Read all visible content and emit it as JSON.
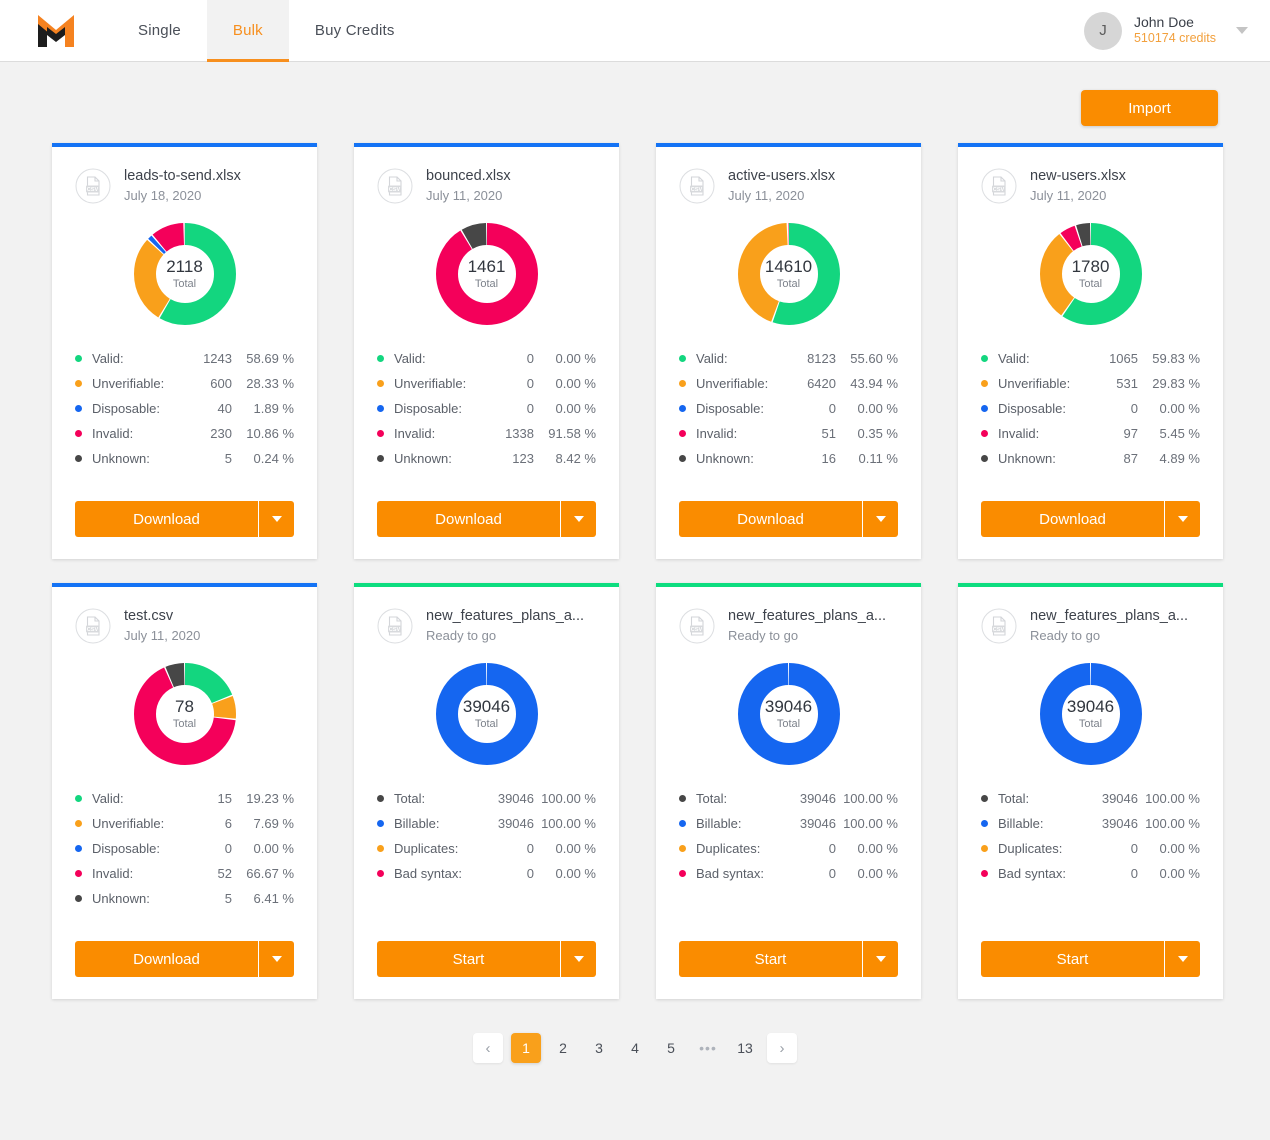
{
  "header": {
    "logo_name": "mailgun-m-logo",
    "nav": [
      {
        "label": "Single",
        "active": false
      },
      {
        "label": "Bulk",
        "active": true
      },
      {
        "label": "Buy Credits",
        "active": false
      }
    ],
    "user": {
      "avatar_initial": "J",
      "name": "John Doe",
      "credits": "510174 credits",
      "caret_icon": "chevron-down-icon"
    }
  },
  "toolbar": {
    "import_label": "Import"
  },
  "colors": {
    "valid": "#13d67f",
    "unverifiable": "#f9a01b",
    "disposable": "#1566f0",
    "invalid": "#f4005a",
    "unknown": "#474747",
    "total": "#474747",
    "billable": "#1566f0",
    "duplicates": "#f9a01b",
    "bad_syntax": "#f4005a",
    "accent_orange": "#fa8c00",
    "card_border_done": "#1473f5",
    "card_border_ready": "#0ddd7f"
  },
  "cards": [
    {
      "file_name": "leads-to-send.xlsx",
      "subtitle": "July 18, 2020",
      "state": "done",
      "total": "2118",
      "total_label": "Total",
      "action_label": "Download",
      "stats": [
        {
          "label": "Valid:",
          "count": "1243",
          "pct": "58.69 %",
          "color_key": "valid",
          "value": 58.69
        },
        {
          "label": "Unverifiable:",
          "count": "600",
          "pct": "28.33 %",
          "color_key": "unverifiable",
          "value": 28.33
        },
        {
          "label": "Disposable:",
          "count": "40",
          "pct": "1.89 %",
          "color_key": "disposable",
          "value": 1.89
        },
        {
          "label": "Invalid:",
          "count": "230",
          "pct": "10.86 %",
          "color_key": "invalid",
          "value": 10.86
        },
        {
          "label": "Unknown:",
          "count": "5",
          "pct": "0.24 %",
          "color_key": "unknown",
          "value": 0.24
        }
      ]
    },
    {
      "file_name": "bounced.xlsx",
      "subtitle": "July 11, 2020",
      "state": "done",
      "total": "1461",
      "total_label": "Total",
      "action_label": "Download",
      "stats": [
        {
          "label": "Valid:",
          "count": "0",
          "pct": "0.00 %",
          "color_key": "valid",
          "value": 0
        },
        {
          "label": "Unverifiable:",
          "count": "0",
          "pct": "0.00 %",
          "color_key": "unverifiable",
          "value": 0
        },
        {
          "label": "Disposable:",
          "count": "0",
          "pct": "0.00 %",
          "color_key": "disposable",
          "value": 0
        },
        {
          "label": "Invalid:",
          "count": "1338",
          "pct": "91.58 %",
          "color_key": "invalid",
          "value": 91.58
        },
        {
          "label": "Unknown:",
          "count": "123",
          "pct": "8.42 %",
          "color_key": "unknown",
          "value": 8.42
        }
      ]
    },
    {
      "file_name": "active-users.xlsx",
      "subtitle": "July 11, 2020",
      "state": "done",
      "total": "14610",
      "total_label": "Total",
      "action_label": "Download",
      "stats": [
        {
          "label": "Valid:",
          "count": "8123",
          "pct": "55.60 %",
          "color_key": "valid",
          "value": 55.6
        },
        {
          "label": "Unverifiable:",
          "count": "6420",
          "pct": "43.94 %",
          "color_key": "unverifiable",
          "value": 43.94
        },
        {
          "label": "Disposable:",
          "count": "0",
          "pct": "0.00 %",
          "color_key": "disposable",
          "value": 0
        },
        {
          "label": "Invalid:",
          "count": "51",
          "pct": "0.35 %",
          "color_key": "invalid",
          "value": 0.35
        },
        {
          "label": "Unknown:",
          "count": "16",
          "pct": "0.11 %",
          "color_key": "unknown",
          "value": 0.11
        }
      ]
    },
    {
      "file_name": "new-users.xlsx",
      "subtitle": "July 11, 2020",
      "state": "done",
      "total": "1780",
      "total_label": "Total",
      "action_label": "Download",
      "stats": [
        {
          "label": "Valid:",
          "count": "1065",
          "pct": "59.83 %",
          "color_key": "valid",
          "value": 59.83
        },
        {
          "label": "Unverifiable:",
          "count": "531",
          "pct": "29.83 %",
          "color_key": "unverifiable",
          "value": 29.83
        },
        {
          "label": "Disposable:",
          "count": "0",
          "pct": "0.00 %",
          "color_key": "disposable",
          "value": 0
        },
        {
          "label": "Invalid:",
          "count": "97",
          "pct": "5.45 %",
          "color_key": "invalid",
          "value": 5.45
        },
        {
          "label": "Unknown:",
          "count": "87",
          "pct": "4.89 %",
          "color_key": "unknown",
          "value": 4.89
        }
      ]
    },
    {
      "file_name": "test.csv",
      "subtitle": "July 11, 2020",
      "state": "done",
      "total": "78",
      "total_label": "Total",
      "action_label": "Download",
      "stats": [
        {
          "label": "Valid:",
          "count": "15",
          "pct": "19.23 %",
          "color_key": "valid",
          "value": 19.23
        },
        {
          "label": "Unverifiable:",
          "count": "6",
          "pct": "7.69 %",
          "color_key": "unverifiable",
          "value": 7.69
        },
        {
          "label": "Disposable:",
          "count": "0",
          "pct": "0.00 %",
          "color_key": "disposable",
          "value": 0
        },
        {
          "label": "Invalid:",
          "count": "52",
          "pct": "66.67 %",
          "color_key": "invalid",
          "value": 66.67
        },
        {
          "label": "Unknown:",
          "count": "5",
          "pct": "6.41 %",
          "color_key": "unknown",
          "value": 6.41
        }
      ]
    },
    {
      "file_name": "new_features_plans_a...",
      "subtitle": "Ready to go",
      "state": "ready",
      "total": "39046",
      "total_label": "Total",
      "action_label": "Start",
      "stats": [
        {
          "label": "Total:",
          "count": "39046",
          "pct": "100.00 %",
          "color_key": "total",
          "value": 0
        },
        {
          "label": "Billable:",
          "count": "39046",
          "pct": "100.00 %",
          "color_key": "billable",
          "value": 100
        },
        {
          "label": "Duplicates:",
          "count": "0",
          "pct": "0.00 %",
          "color_key": "duplicates",
          "value": 0
        },
        {
          "label": "Bad syntax:",
          "count": "0",
          "pct": "0.00 %",
          "color_key": "bad_syntax",
          "value": 0
        }
      ]
    },
    {
      "file_name": "new_features_plans_a...",
      "subtitle": "Ready to go",
      "state": "ready",
      "total": "39046",
      "total_label": "Total",
      "action_label": "Start",
      "stats": [
        {
          "label": "Total:",
          "count": "39046",
          "pct": "100.00 %",
          "color_key": "total",
          "value": 0
        },
        {
          "label": "Billable:",
          "count": "39046",
          "pct": "100.00 %",
          "color_key": "billable",
          "value": 100
        },
        {
          "label": "Duplicates:",
          "count": "0",
          "pct": "0.00 %",
          "color_key": "duplicates",
          "value": 0
        },
        {
          "label": "Bad syntax:",
          "count": "0",
          "pct": "0.00 %",
          "color_key": "bad_syntax",
          "value": 0
        }
      ]
    },
    {
      "file_name": "new_features_plans_a...",
      "subtitle": "Ready to go",
      "state": "ready",
      "total": "39046",
      "total_label": "Total",
      "action_label": "Start",
      "stats": [
        {
          "label": "Total:",
          "count": "39046",
          "pct": "100.00 %",
          "color_key": "total",
          "value": 0
        },
        {
          "label": "Billable:",
          "count": "39046",
          "pct": "100.00 %",
          "color_key": "billable",
          "value": 100
        },
        {
          "label": "Duplicates:",
          "count": "0",
          "pct": "0.00 %",
          "color_key": "duplicates",
          "value": 0
        },
        {
          "label": "Bad syntax:",
          "count": "0",
          "pct": "0.00 %",
          "color_key": "bad_syntax",
          "value": 0
        }
      ]
    }
  ],
  "pagination": {
    "prev_icon": "chevron-left-icon",
    "next_icon": "chevron-right-icon",
    "prev_label": "‹",
    "next_label": "›",
    "ellipsis": "•••",
    "pages": [
      "1",
      "2",
      "3",
      "4",
      "5"
    ],
    "last_page": "13",
    "current": "1"
  },
  "chart_data": [
    {
      "type": "pie",
      "title": "leads-to-send.xlsx",
      "labels": [
        "Valid",
        "Unverifiable",
        "Disposable",
        "Invalid",
        "Unknown"
      ],
      "values": [
        1243,
        600,
        40,
        230,
        5
      ],
      "percents": [
        58.69,
        28.33,
        1.89,
        10.86,
        0.24
      ],
      "total": 2118
    },
    {
      "type": "pie",
      "title": "bounced.xlsx",
      "labels": [
        "Valid",
        "Unverifiable",
        "Disposable",
        "Invalid",
        "Unknown"
      ],
      "values": [
        0,
        0,
        0,
        1338,
        123
      ],
      "percents": [
        0,
        0,
        0,
        91.58,
        8.42
      ],
      "total": 1461
    },
    {
      "type": "pie",
      "title": "active-users.xlsx",
      "labels": [
        "Valid",
        "Unverifiable",
        "Disposable",
        "Invalid",
        "Unknown"
      ],
      "values": [
        8123,
        6420,
        0,
        51,
        16
      ],
      "percents": [
        55.6,
        43.94,
        0,
        0.35,
        0.11
      ],
      "total": 14610
    },
    {
      "type": "pie",
      "title": "new-users.xlsx",
      "labels": [
        "Valid",
        "Unverifiable",
        "Disposable",
        "Invalid",
        "Unknown"
      ],
      "values": [
        1065,
        531,
        0,
        97,
        87
      ],
      "percents": [
        59.83,
        29.83,
        0,
        5.45,
        4.89
      ],
      "total": 1780
    },
    {
      "type": "pie",
      "title": "test.csv",
      "labels": [
        "Valid",
        "Unverifiable",
        "Disposable",
        "Invalid",
        "Unknown"
      ],
      "values": [
        15,
        6,
        0,
        52,
        5
      ],
      "percents": [
        19.23,
        7.69,
        0,
        66.67,
        6.41
      ],
      "total": 78
    },
    {
      "type": "pie",
      "title": "new_features_plans_a...",
      "labels": [
        "Billable",
        "Duplicates",
        "Bad syntax"
      ],
      "values": [
        39046,
        0,
        0
      ],
      "percents": [
        100,
        0,
        0
      ],
      "total": 39046
    },
    {
      "type": "pie",
      "title": "new_features_plans_a...",
      "labels": [
        "Billable",
        "Duplicates",
        "Bad syntax"
      ],
      "values": [
        39046,
        0,
        0
      ],
      "percents": [
        100,
        0,
        0
      ],
      "total": 39046
    },
    {
      "type": "pie",
      "title": "new_features_plans_a...",
      "labels": [
        "Billable",
        "Duplicates",
        "Bad syntax"
      ],
      "values": [
        39046,
        0,
        0
      ],
      "percents": [
        100,
        0,
        0
      ],
      "total": 39046
    }
  ]
}
